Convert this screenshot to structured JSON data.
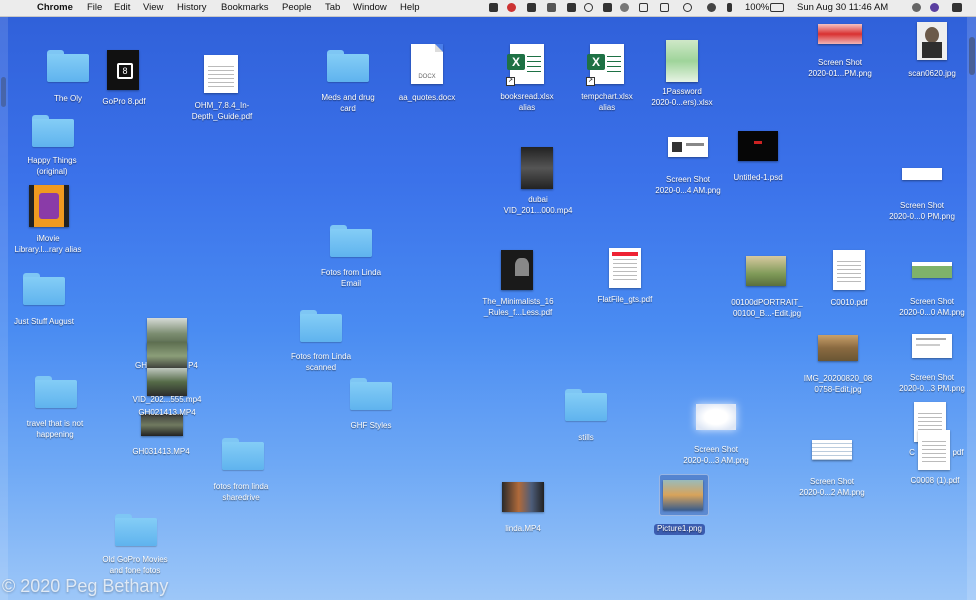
{
  "menubar": {
    "app": "Chrome",
    "menus": [
      "File",
      "Edit",
      "View",
      "History",
      "Bookmarks",
      "People",
      "Tab",
      "Window",
      "Help"
    ],
    "battery": "100%",
    "clock": "Sun Aug 30  11:46 AM"
  },
  "desktop": {
    "the_oly": "The Oly",
    "gopro_pdf": "GoPro 8.pdf",
    "ohm_pdf_1": "OHM_7.8.4_In-",
    "ohm_pdf_2": "Depth_Guide.pdf",
    "meds_1": "Meds and drug",
    "meds_2": "card",
    "aa_quotes": "aa_quotes.docx",
    "docx_tag": "DOCX",
    "booksread_1": "booksread.xlsx",
    "booksread_2": "alias",
    "tempchart_1": "tempchart.xlsx",
    "tempchart_2": "alias",
    "onepass_1": "1Password",
    "onepass_2": "2020-0...ers).xlsx",
    "ss_top_1": "Screen Shot",
    "ss_top_2": "2020-01...PM.png",
    "scan": "scan0620.jpg",
    "happy_1": "Happy Things",
    "happy_2": "(original)",
    "ss_4am_1": "Screen Shot",
    "ss_4am_2": "2020-0...4 AM.png",
    "untitled": "Untitled-1.psd",
    "ss_0pm_1": "Screen Shot",
    "ss_0pm_2": "2020-0...0 PM.png",
    "dubai_1": "dubai",
    "dubai_2": "VID_201...000.mp4",
    "imovie_1": "iMovie",
    "imovie_2": "Library.l...rary alias",
    "fotos_email_1": "Fotos from Linda",
    "fotos_email_2": "Email",
    "just_stuff": "Just Stuff August",
    "minimalists_1": "The_Minimalists_16",
    "minimalists_2": "_Rules_f...Less.pdf",
    "flatfile": "FlatFile_gts.pdf",
    "portrait_1": "00100dPORTRAIT_",
    "portrait_2": "00100_B...-Edit.jpg",
    "c0010": "C0010.pdf",
    "ss_0am_1": "Screen Shot",
    "ss_0am_2": "2020-0...0 AM.png",
    "gh_p4": "GH",
    "gh_p4_b": "P4",
    "vid_555": "VID_202...555.mp4",
    "gh021413": "GH021413.MP4",
    "gh031413": "GH031413.MP4",
    "fotos_scanned_1": "Fotos from Linda",
    "fotos_scanned_2": "scanned",
    "img_0758_1": "IMG_20200820_08",
    "img_0758_2": "0758-Edit.jpg",
    "ss_3pm_1": "Screen Shot",
    "ss_3pm_2": "2020-0...3 PM.png",
    "travel_1": "travel that is not",
    "travel_2": "happening",
    "ghf": "GHF Styles",
    "stills": "stills",
    "ss_3am_1": "Screen Shot",
    "ss_3am_2": "2020-0...3 AM.png",
    "c000_partial": "C",
    "c000_partial_b": "pdf",
    "ss_2am_1": "Screen Shot",
    "ss_2am_2": "2020-0...2 AM.png",
    "c0008": "C0008 (1).pdf",
    "fotos_share_1": "fotos from linda",
    "fotos_share_2": "sharedrive",
    "linda_mp4": "linda.MP4",
    "picture1": "Picture1.png",
    "old_gopro_1": "Old GoPro Movies",
    "old_gopro_2": "and fone fotos"
  },
  "watermark": "© 2020 Peg Bethany"
}
